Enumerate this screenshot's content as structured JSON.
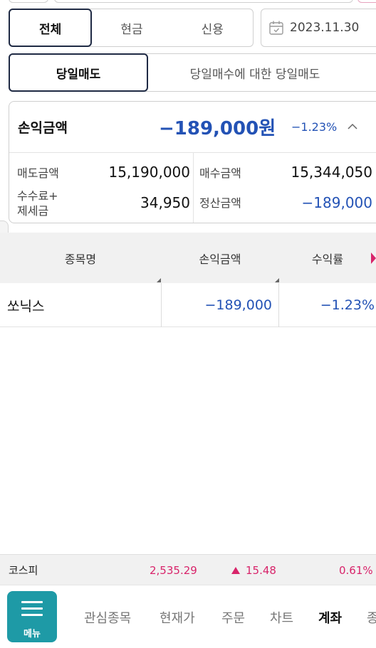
{
  "segment": {
    "all": "전체",
    "cash": "현금",
    "credit": "신용"
  },
  "date": "2023.11.30",
  "subsegment": {
    "day_sell": "당일매도",
    "day_sell_of_day_buy": "당일매수에 대한 당일매도"
  },
  "summary": {
    "pl_label": "손익금액",
    "pl_amount": "−189,000원",
    "pl_rate": "−1.23%",
    "sell_amount_label": "매도금액",
    "sell_amount": "15,190,000",
    "buy_amount_label": "매수금액",
    "buy_amount": "15,344,050",
    "fee_tax_label_line1": "수수료+",
    "fee_tax_label_line2": "제세금",
    "fee_tax": "34,950",
    "settle_label": "정산금액",
    "settle_amount": "−189,000"
  },
  "table": {
    "headers": [
      "종목명",
      "손익금액",
      "수익률"
    ],
    "rows": [
      {
        "name": "쏘닉스",
        "pl": "−189,000",
        "rate": "−1.23%"
      }
    ]
  },
  "market": {
    "index": "코스피",
    "value": "2,535.29",
    "change": "15.48",
    "rate": "0.61%"
  },
  "nav": {
    "menu": "메뉴",
    "items": [
      "관심종목",
      "현재가",
      "주문",
      "차트",
      "계좌",
      "종"
    ]
  },
  "colors": {
    "blue": "#2352b5",
    "red": "#d8246a",
    "teal": "#1e9aa6",
    "navy": "#1f2a44"
  }
}
